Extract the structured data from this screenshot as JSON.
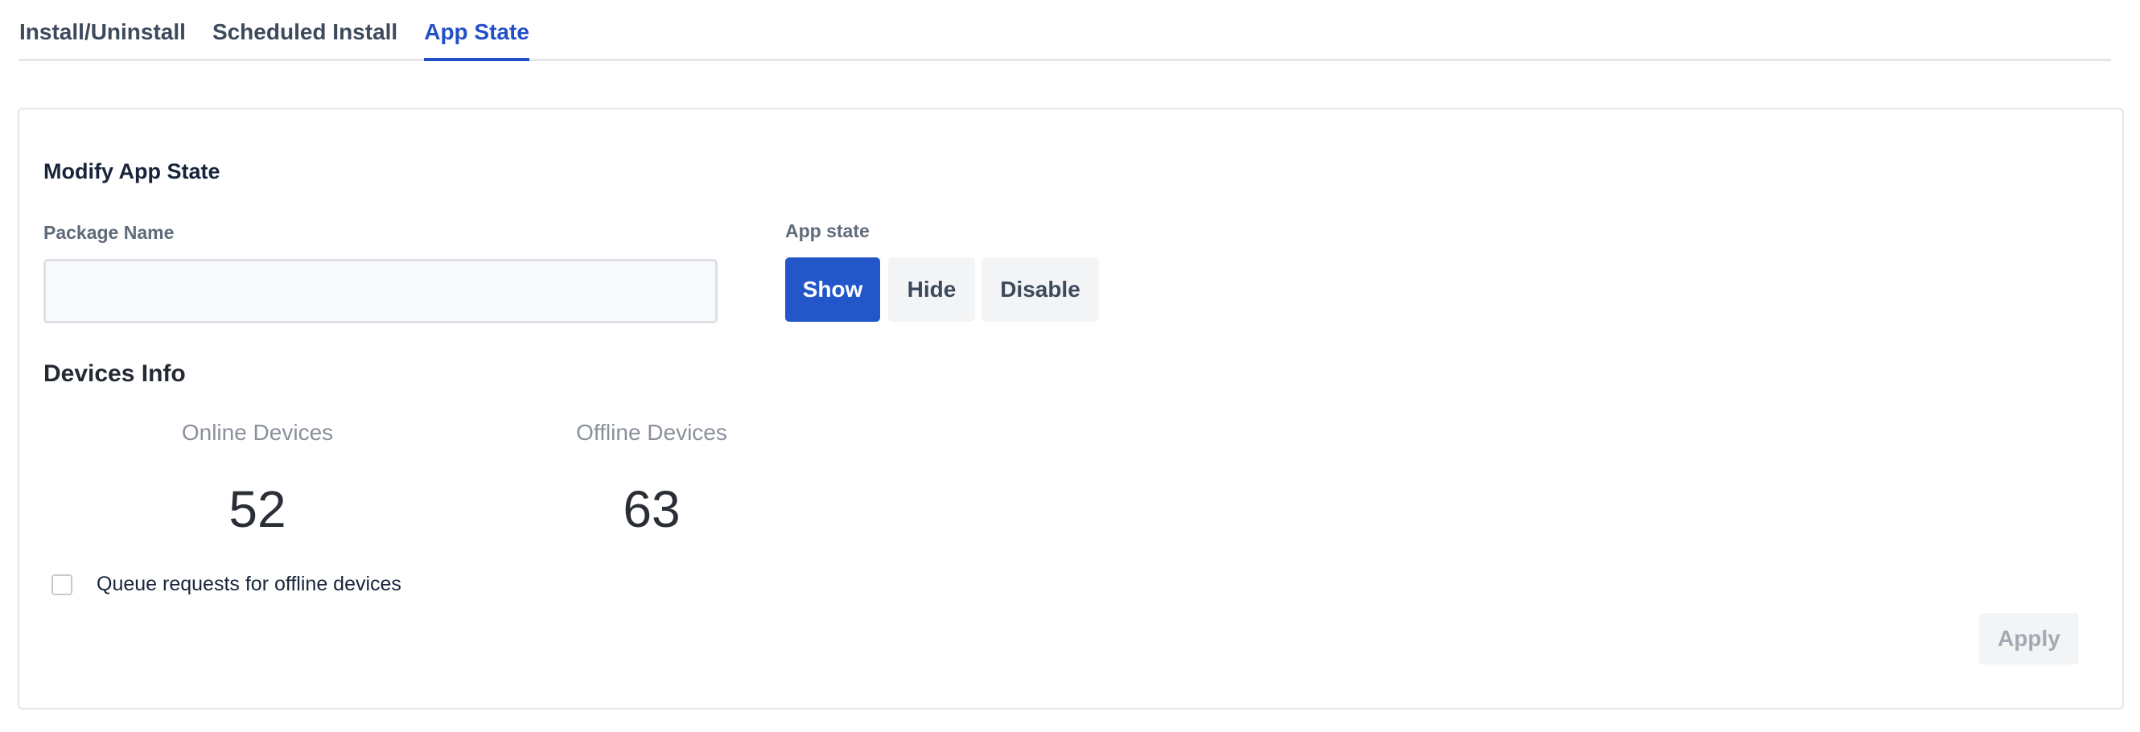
{
  "tabs": [
    {
      "label": "Install/Uninstall",
      "active": false
    },
    {
      "label": "Scheduled Install",
      "active": false
    },
    {
      "label": "App State",
      "active": true
    }
  ],
  "form": {
    "title": "Modify App State",
    "package_label": "Package Name",
    "package_value": "",
    "package_placeholder": "",
    "state_label": "App state",
    "state_options": [
      "Show",
      "Hide",
      "Disable"
    ],
    "state_selected": "Show"
  },
  "devices": {
    "title": "Devices Info",
    "online_label": "Online Devices",
    "online_count": "52",
    "offline_label": "Offline Devices",
    "offline_count": "63"
  },
  "queue": {
    "label": "Queue requests for offline devices",
    "checked": false
  },
  "apply_label": "Apply",
  "colors": {
    "accent": "#2256c9",
    "tab_active": "#2250c8",
    "muted_button_bg": "#f3f4f6",
    "disabled_text": "#a4aab3"
  }
}
